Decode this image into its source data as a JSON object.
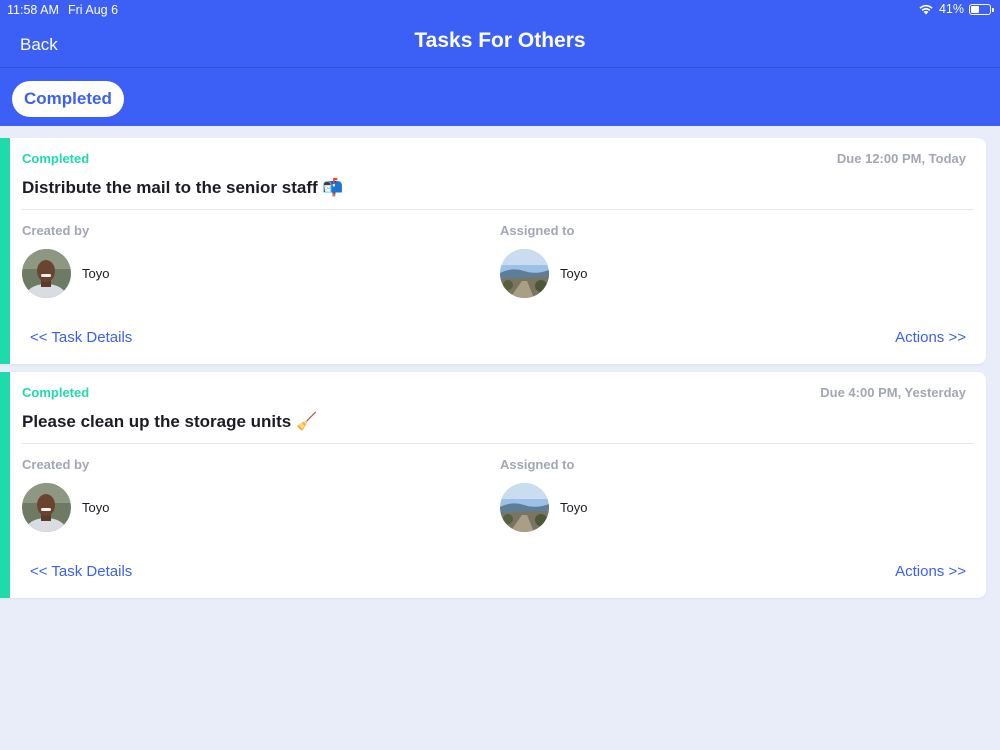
{
  "status_bar": {
    "time": "11:58 AM",
    "date": "Fri Aug 6",
    "battery": "41%",
    "wifi_icon": "wifi-icon",
    "battery_icon": "battery-icon"
  },
  "nav": {
    "back_label": "Back",
    "title": "Tasks For Others"
  },
  "filter": {
    "label": "Completed"
  },
  "colors": {
    "brand": "#3c5ff5",
    "status_completed": "#1fdbac",
    "background": "#e8edf9"
  },
  "tasks": [
    {
      "status": "Completed",
      "due": "Due 12:00 PM, Today",
      "title": "Distribute the mail to the senior staff 📬",
      "created_by_label": "Created by",
      "created_by_name": "Toyo",
      "assigned_to_label": "Assigned to",
      "assigned_to_name": "Toyo",
      "details_link": "<< Task Details",
      "actions_link": "Actions >>"
    },
    {
      "status": "Completed",
      "due": "Due 4:00 PM, Yesterday",
      "title": "Please clean up the storage units 🧹",
      "created_by_label": "Created by",
      "created_by_name": "Toyo",
      "assigned_to_label": "Assigned to",
      "assigned_to_name": "Toyo",
      "details_link": "<< Task Details",
      "actions_link": "Actions >>"
    }
  ]
}
